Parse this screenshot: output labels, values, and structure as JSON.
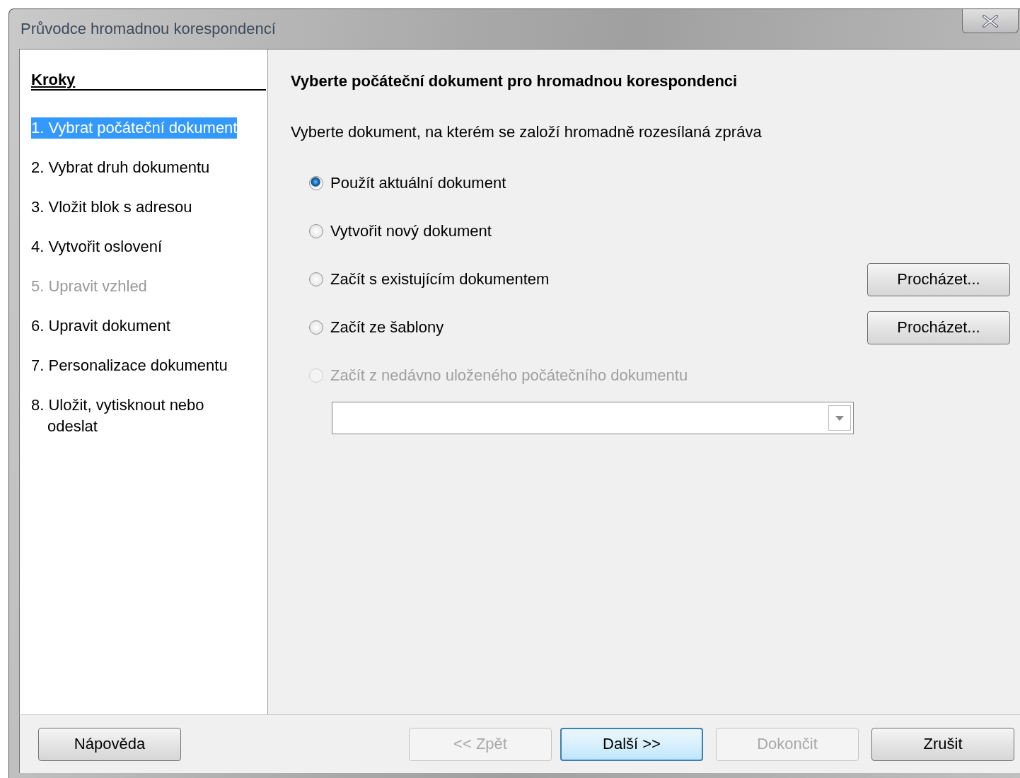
{
  "window": {
    "title": "Průvodce hromadnou korespondencí"
  },
  "steps": {
    "heading": "Kroky",
    "items": [
      {
        "label": "1. Vybrat počáteční dokument",
        "selected": true,
        "disabled": false
      },
      {
        "label": "2. Vybrat druh dokumentu",
        "selected": false,
        "disabled": false
      },
      {
        "label": "3. Vložit blok s adresou",
        "selected": false,
        "disabled": false
      },
      {
        "label": "4. Vytvořit oslovení",
        "selected": false,
        "disabled": false
      },
      {
        "label": "5. Upravit vzhled",
        "selected": false,
        "disabled": true
      },
      {
        "label": "6. Upravit dokument",
        "selected": false,
        "disabled": false
      },
      {
        "label": "7. Personalizace dokumentu",
        "selected": false,
        "disabled": false
      },
      {
        "label": "8. Uložit, vytisknout nebo odeslat",
        "selected": false,
        "disabled": false
      }
    ]
  },
  "page": {
    "heading": "Vyberte počáteční dokument pro hromadnou korespondenci",
    "description": "Vyberte dokument, na kterém se založí hromadně rozesílaná zpráva",
    "options": [
      {
        "label": "Použít aktuální dokument",
        "selected": true,
        "disabled": false
      },
      {
        "label": "Vytvořit nový dokument",
        "selected": false,
        "disabled": false
      },
      {
        "label": "Začít s existujícím dokumentem",
        "selected": false,
        "disabled": false,
        "button": "Procházet..."
      },
      {
        "label": "Začít ze šablony",
        "selected": false,
        "disabled": false,
        "button": "Procházet..."
      },
      {
        "label": "Začít z nedávno uloženého počátečního dokumentu",
        "selected": false,
        "disabled": true
      }
    ]
  },
  "buttons": [
    {
      "label": "Nápověda",
      "disabled": false,
      "default": false
    },
    {
      "label": "<< Zpět",
      "disabled": true,
      "default": false
    },
    {
      "label": "Další >>",
      "disabled": false,
      "default": true
    },
    {
      "label": "Dokončit",
      "disabled": true,
      "default": false
    },
    {
      "label": "Zrušit",
      "disabled": false,
      "default": false
    }
  ]
}
